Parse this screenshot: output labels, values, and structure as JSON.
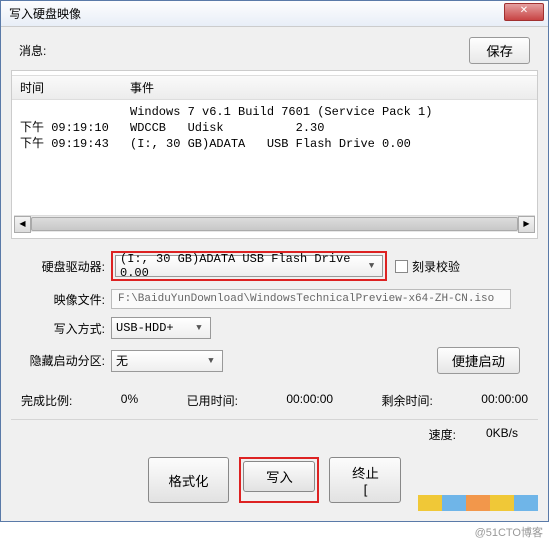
{
  "window": {
    "title": "写入硬盘映像"
  },
  "msg": {
    "label": "消息:",
    "save": "保存",
    "cols": {
      "time": "时间",
      "event": "事件"
    },
    "rows": [
      {
        "time": "",
        "event": "Windows 7 v6.1 Build 7601 (Service Pack 1)"
      },
      {
        "time": "下午 09:19:10",
        "event": "WDCCB   Udisk          2.30"
      },
      {
        "time": "下午 09:19:43",
        "event": "(I:, 30 GB)ADATA   USB Flash Drive 0.00"
      }
    ]
  },
  "form": {
    "drive_label": "硬盘驱动器:",
    "drive_value": "(I:, 30 GB)ADATA   USB Flash Drive 0.00",
    "burn_check": "刻录校验",
    "image_label": "映像文件:",
    "image_value": "F:\\BaiduYunDownload\\WindowsTechnicalPreview-x64-ZH-CN.iso",
    "write_label": "写入方式:",
    "write_value": "USB-HDD+",
    "hide_label": "隐藏启动分区:",
    "hide_value": "无",
    "bootable_btn": "便捷启动"
  },
  "progress": {
    "done_label": "完成比例:",
    "done_value": "0%",
    "elapsed_label": "已用时间:",
    "elapsed_value": "00:00:00",
    "remain_label": "剩余时间:",
    "remain_value": "00:00:00",
    "speed_label": "速度:",
    "speed_value": "0KB/s"
  },
  "buttons": {
    "format": "格式化",
    "write": "写入",
    "abort": "终止[",
    "return": ""
  },
  "watermark": "@51CTO博客"
}
